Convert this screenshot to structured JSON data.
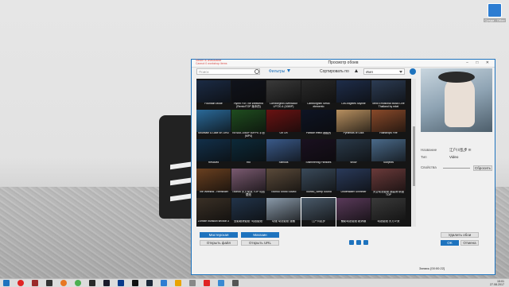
{
  "desktop": {
    "icon_label": "Среда - Обои"
  },
  "window": {
    "title": "Просмотр обоев",
    "notice_line1": "Steam is unavailable",
    "notice_line2": "Cannot 0 workshop items",
    "controls": "− □ ✕"
  },
  "toolbar": {
    "search_placeholder": "Поиск",
    "filters_label": "Фильтры",
    "sort_label": "Сортировать по",
    "sort_value": "Имя"
  },
  "wallpapers": [
    {
      "name": "Fountain Mode",
      "color": "#1b2b45"
    },
    {
      "name": "Hymn For The Weekend (Remix/TOP 版本的)",
      "color": "#10131c"
    },
    {
      "name": "Lamborghini Aventador LP720-4 (1080P)",
      "color": "#3a3a3a"
    },
    {
      "name": "Lamborghini Sesto elemento",
      "color": "#2a2a2a"
    },
    {
      "name": "Los Angeles Skyline",
      "color": "#1e2d4a"
    },
    {
      "name": "Mind Emotional Music Live Thailand by mkei",
      "color": "#2c3c54"
    },
    {
      "name": "Mountain & Lake 4K UHD",
      "color": "#2a6a9a"
    },
    {
      "name": "NVIDIA 1080P 60FPS 平台 (MP4)",
      "color": "#1f4d1f"
    },
    {
      "name": "Oh Oh",
      "color": "#6a1212"
    },
    {
      "name": "Particle effect 超酷的",
      "color": "#0e1424"
    },
    {
      "name": "Pyramids of Giza",
      "color": "#b89060"
    },
    {
      "name": "Raindrops Fire",
      "color": "#8a4a2a"
    },
    {
      "name": "Rescued",
      "color": "#12304a"
    },
    {
      "name": "Rio",
      "color": "#0c2a3a"
    },
    {
      "name": "Sillhous",
      "color": "#3a5a8a"
    },
    {
      "name": "Shimmering Particles",
      "color": "#1a1020"
    },
    {
      "name": "snow",
      "color": "#2a3a4a"
    },
    {
      "name": "Subjects",
      "color": "#4a6a8a"
    },
    {
      "name": "The Weeknd - Reminder",
      "color": "#6a4020"
    },
    {
      "name": "Touhou 东方女孩 TOP 动态壁纸",
      "color": "#7a5a70"
    },
    {
      "name": "Touhou Shoto Sound",
      "color": "#5a4a3a"
    },
    {
      "name": "Touhou_Sleep Sound",
      "color": "#3a4a5a"
    },
    {
      "name": "Underwater Shimmer",
      "color": "#2a3a5a"
    },
    {
      "name": "天空动态壁纸 超高清 精品 TOP",
      "color": "#6a3a3a"
    },
    {
      "name": "Zombie Invasion section 3",
      "color": "#3a3026"
    },
    {
      "name": "全影超清壁纸 “动态壁纸”",
      "color": "#22344a"
    },
    {
      "name": "动漫 动态壁纸 漫画",
      "color": "#8a9aaa"
    },
    {
      "name": "江户川乱步",
      "color": "#4a5a6a"
    },
    {
      "name": "魅影动态壁纸 超清版",
      "color": "#5a3a5a"
    },
    {
      "name": "动态壁纸 东方少女",
      "color": "#3a3a3a"
    }
  ],
  "bottom_buttons": {
    "workshop": "Мастерская",
    "shop": "Магазин",
    "open_file": "Открыть файл",
    "open_url": "Открыть URL"
  },
  "details": {
    "name_label": "Название",
    "name_value": "江户川乱步 !!!",
    "type_label": "Тип",
    "type_value": "Video",
    "props_label": "Свойства",
    "reset_label": "Сбросить",
    "delete_label": "Удалить обои",
    "ok_label": "OK",
    "cancel_label": "Отмена"
  },
  "status": {
    "record": "Запись [00:00:22]",
    "time": "15:01",
    "date": "27.08.2017"
  }
}
